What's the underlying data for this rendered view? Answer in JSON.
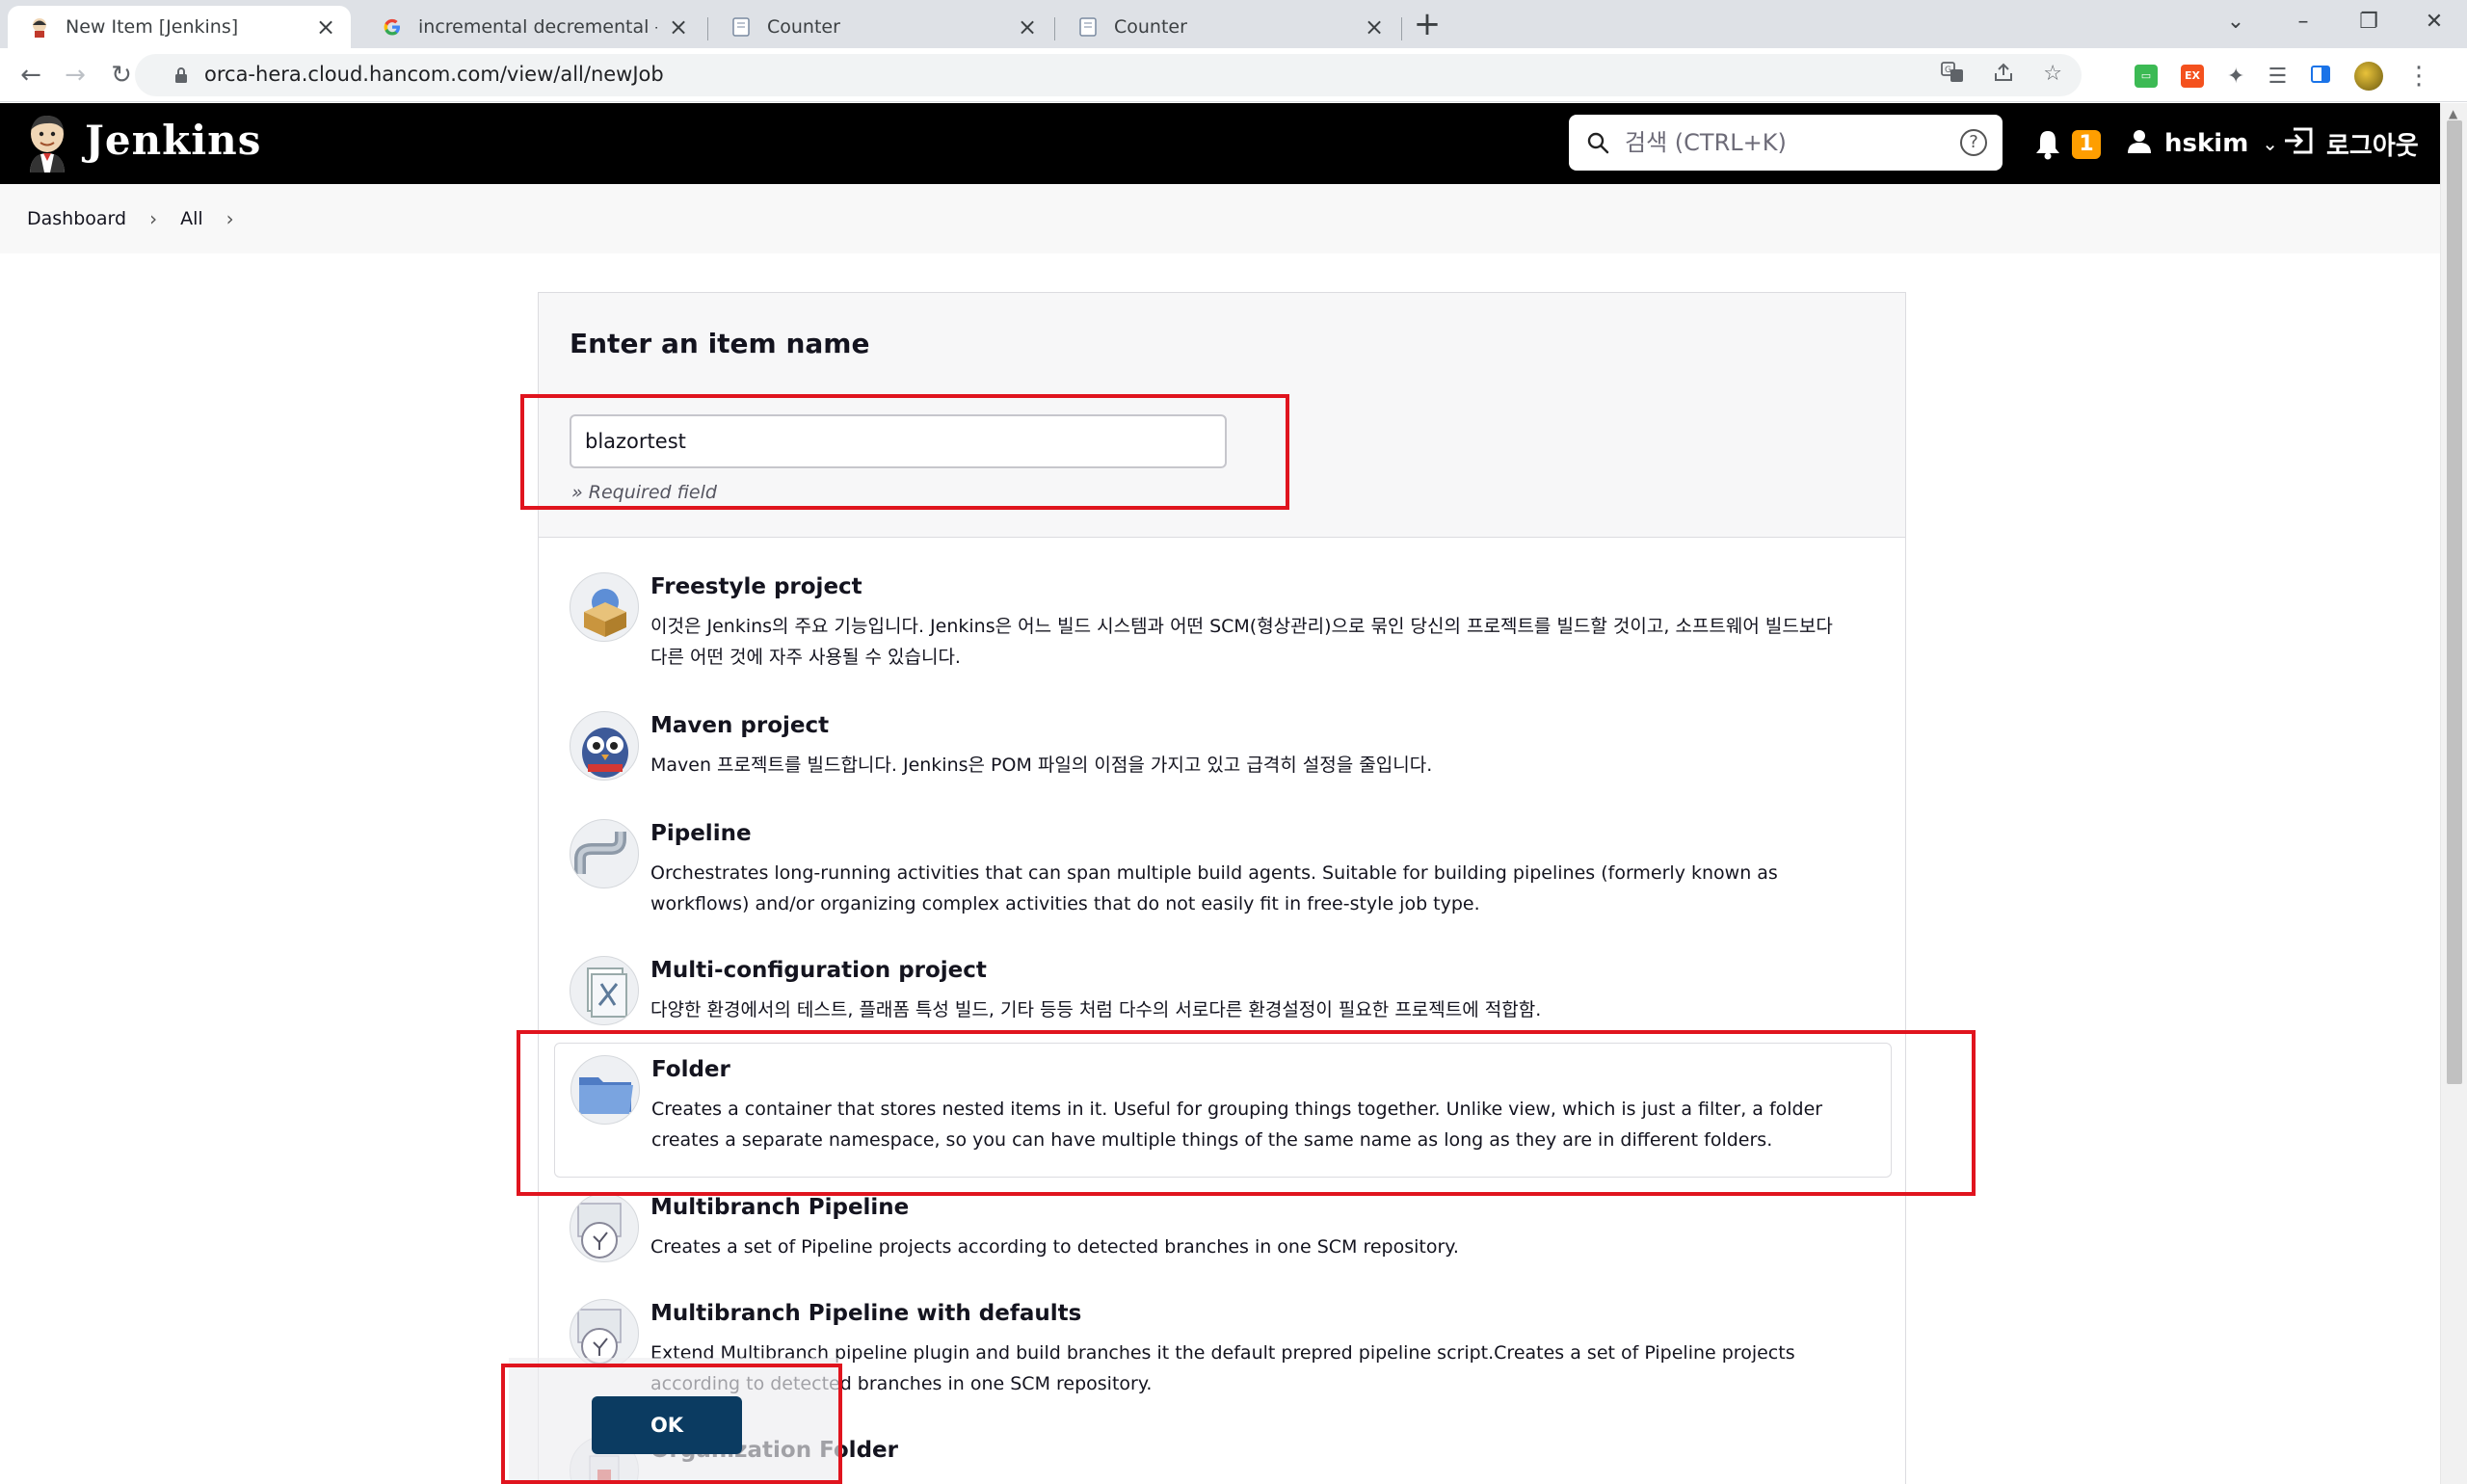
{
  "browser": {
    "tabs": [
      {
        "title": "New Item [Jenkins]",
        "active": true
      },
      {
        "title": "incremental decremental - Goo",
        "active": false
      },
      {
        "title": "Counter",
        "active": false
      },
      {
        "title": "Counter",
        "active": false
      }
    ],
    "url": "orca-hera.cloud.hancom.com/view/all/newJob",
    "extension_label": "EX"
  },
  "jenkins": {
    "brand": "Jenkins",
    "search_placeholder": "검색 (CTRL+K)",
    "help_symbol": "?",
    "notification_count": "1",
    "username": "hskim",
    "logout_label": "로그아웃"
  },
  "breadcrumb": [
    "Dashboard",
    "All"
  ],
  "form": {
    "title": "Enter an item name",
    "item_name_value": "blazortest",
    "required_hint": "» Required field"
  },
  "item_types": [
    {
      "name": "Freestyle project",
      "description": "이것은 Jenkins의 주요 기능입니다. Jenkins은 어느 빌드 시스템과 어떤 SCM(형상관리)으로 묶인 당신의 프로젝트를 빌드할 것이고, 소프트웨어 빌드보다 다른 어떤 것에 자주 사용될 수 있습니다.",
      "icon": "freestyle-box-icon"
    },
    {
      "name": "Maven project",
      "description": "Maven 프로젝트를 빌드합니다. Jenkins은 POM 파일의 이점을 가지고 있고 급격히 설정을 줄입니다.",
      "icon": "maven-owl-icon"
    },
    {
      "name": "Pipeline",
      "description": "Orchestrates long-running activities that can span multiple build agents. Suitable for building pipelines (formerly known as workflows) and/or organizing complex activities that do not easily fit in free-style job type.",
      "icon": "pipeline-pipe-icon"
    },
    {
      "name": "Multi-configuration project",
      "description": "다양한 환경에서의 테스트, 플래폼 특성 빌드, 기타 등등 처럼 다수의 서로다른 환경설정이 필요한 프로젝트에 적합함.",
      "icon": "multi-config-icon"
    },
    {
      "name": "Folder",
      "description": "Creates a container that stores nested items in it. Useful for grouping things together. Unlike view, which is just a filter, a folder creates a separate namespace, so you can have multiple things of the same name as long as they are in different folders.",
      "icon": "folder-icon",
      "selected": true
    },
    {
      "name": "Multibranch Pipeline",
      "description": "Creates a set of Pipeline projects according to detected branches in one SCM repository.",
      "icon": "multibranch-icon"
    },
    {
      "name": "Multibranch Pipeline with defaults",
      "description": "Extend Multibranch pipeline plugin and build branches it the default prepred pipeline script.Creates a set of Pipeline projects according to detected branches in one SCM repository.",
      "icon": "multibranch-defaults-icon"
    },
    {
      "name": "Organization Folder",
      "description": "",
      "icon": "organization-folder-icon"
    }
  ],
  "ok_label": "OK",
  "colors": {
    "jenkins_header": "#000000",
    "ok_button": "#0b3b61",
    "annotation_red": "#e0141e",
    "notification_badge": "#fe9e00"
  }
}
